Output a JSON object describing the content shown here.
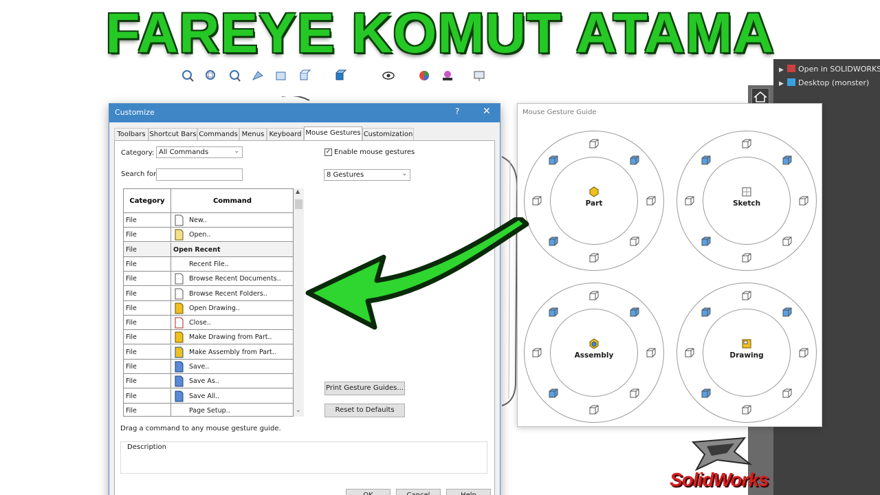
{
  "banner": {
    "title": "FAREYE KOMUT ATAMA"
  },
  "right_panel": {
    "items": [
      {
        "label": "Open in SOLIDWORKS",
        "icon": "solidworks-icon"
      },
      {
        "label": "Desktop (monster)",
        "icon": "desktop-icon"
      }
    ]
  },
  "dialog": {
    "title": "Customize",
    "help_label": "?",
    "close_label": "✕",
    "tabs": [
      "Toolbars",
      "Shortcut Bars",
      "Commands",
      "Menus",
      "Keyboard",
      "Mouse Gestures",
      "Customization"
    ],
    "active_tab": "Mouse Gestures",
    "category_label": "Category:",
    "category_value": "All Commands",
    "search_label": "Search for:",
    "search_value": "",
    "enable_label": "Enable mouse gestures",
    "enable_checked": true,
    "gestures_value": "8 Gestures",
    "table": {
      "headers": {
        "category": "Category",
        "command": "Command"
      },
      "rows": [
        {
          "category": "File",
          "command": "New..",
          "icon": "new-document-icon",
          "group": false
        },
        {
          "category": "File",
          "command": "Open..",
          "icon": "open-folder-icon",
          "group": false
        },
        {
          "category": "File",
          "command": "Open Recent",
          "icon": "",
          "group": true
        },
        {
          "category": "File",
          "command": "Recent File..",
          "icon": "",
          "group": false
        },
        {
          "category": "File",
          "command": "Browse Recent Documents..",
          "icon": "browse-recent-documents-icon",
          "group": false
        },
        {
          "category": "File",
          "command": "Browse Recent Folders..",
          "icon": "browse-recent-folders-icon",
          "group": false
        },
        {
          "category": "File",
          "command": "Open Drawing..",
          "icon": "open-drawing-icon",
          "group": false
        },
        {
          "category": "File",
          "command": "Close..",
          "icon": "close-document-icon",
          "group": false
        },
        {
          "category": "File",
          "command": "Make Drawing from Part..",
          "icon": "make-drawing-icon",
          "group": false
        },
        {
          "category": "File",
          "command": "Make Assembly from Part..",
          "icon": "make-assembly-icon",
          "group": false
        },
        {
          "category": "File",
          "command": "Save..",
          "icon": "save-icon",
          "group": false
        },
        {
          "category": "File",
          "command": "Save As..",
          "icon": "save-as-icon",
          "group": false
        },
        {
          "category": "File",
          "command": "Save All..",
          "icon": "save-all-icon",
          "group": false
        },
        {
          "category": "File",
          "command": "Page Setup..",
          "icon": "",
          "group": false
        }
      ]
    },
    "print_button": "Print Gesture Guides...",
    "reset_button": "Reset to Defaults",
    "hint": "Drag a command to any mouse gesture guide.",
    "description_label": "Description",
    "bottom_buttons": [
      "OK",
      "Cancel",
      "Help"
    ]
  },
  "gesture_guide": {
    "title": "Mouse Gesture Guide",
    "wheels": [
      {
        "label": "Part",
        "center_icon": "part-icon"
      },
      {
        "label": "Sketch",
        "center_icon": "sketch-icon"
      },
      {
        "label": "Assembly",
        "center_icon": "assembly-icon"
      },
      {
        "label": "Drawing",
        "center_icon": "drawing-icon"
      }
    ]
  },
  "logo": {
    "text": "SolidWorks"
  },
  "colors": {
    "banner_green": "#26c826",
    "arrow_green": "#2fd62f",
    "dialog_blue": "#3f86c7",
    "logo_red": "#d42020"
  }
}
